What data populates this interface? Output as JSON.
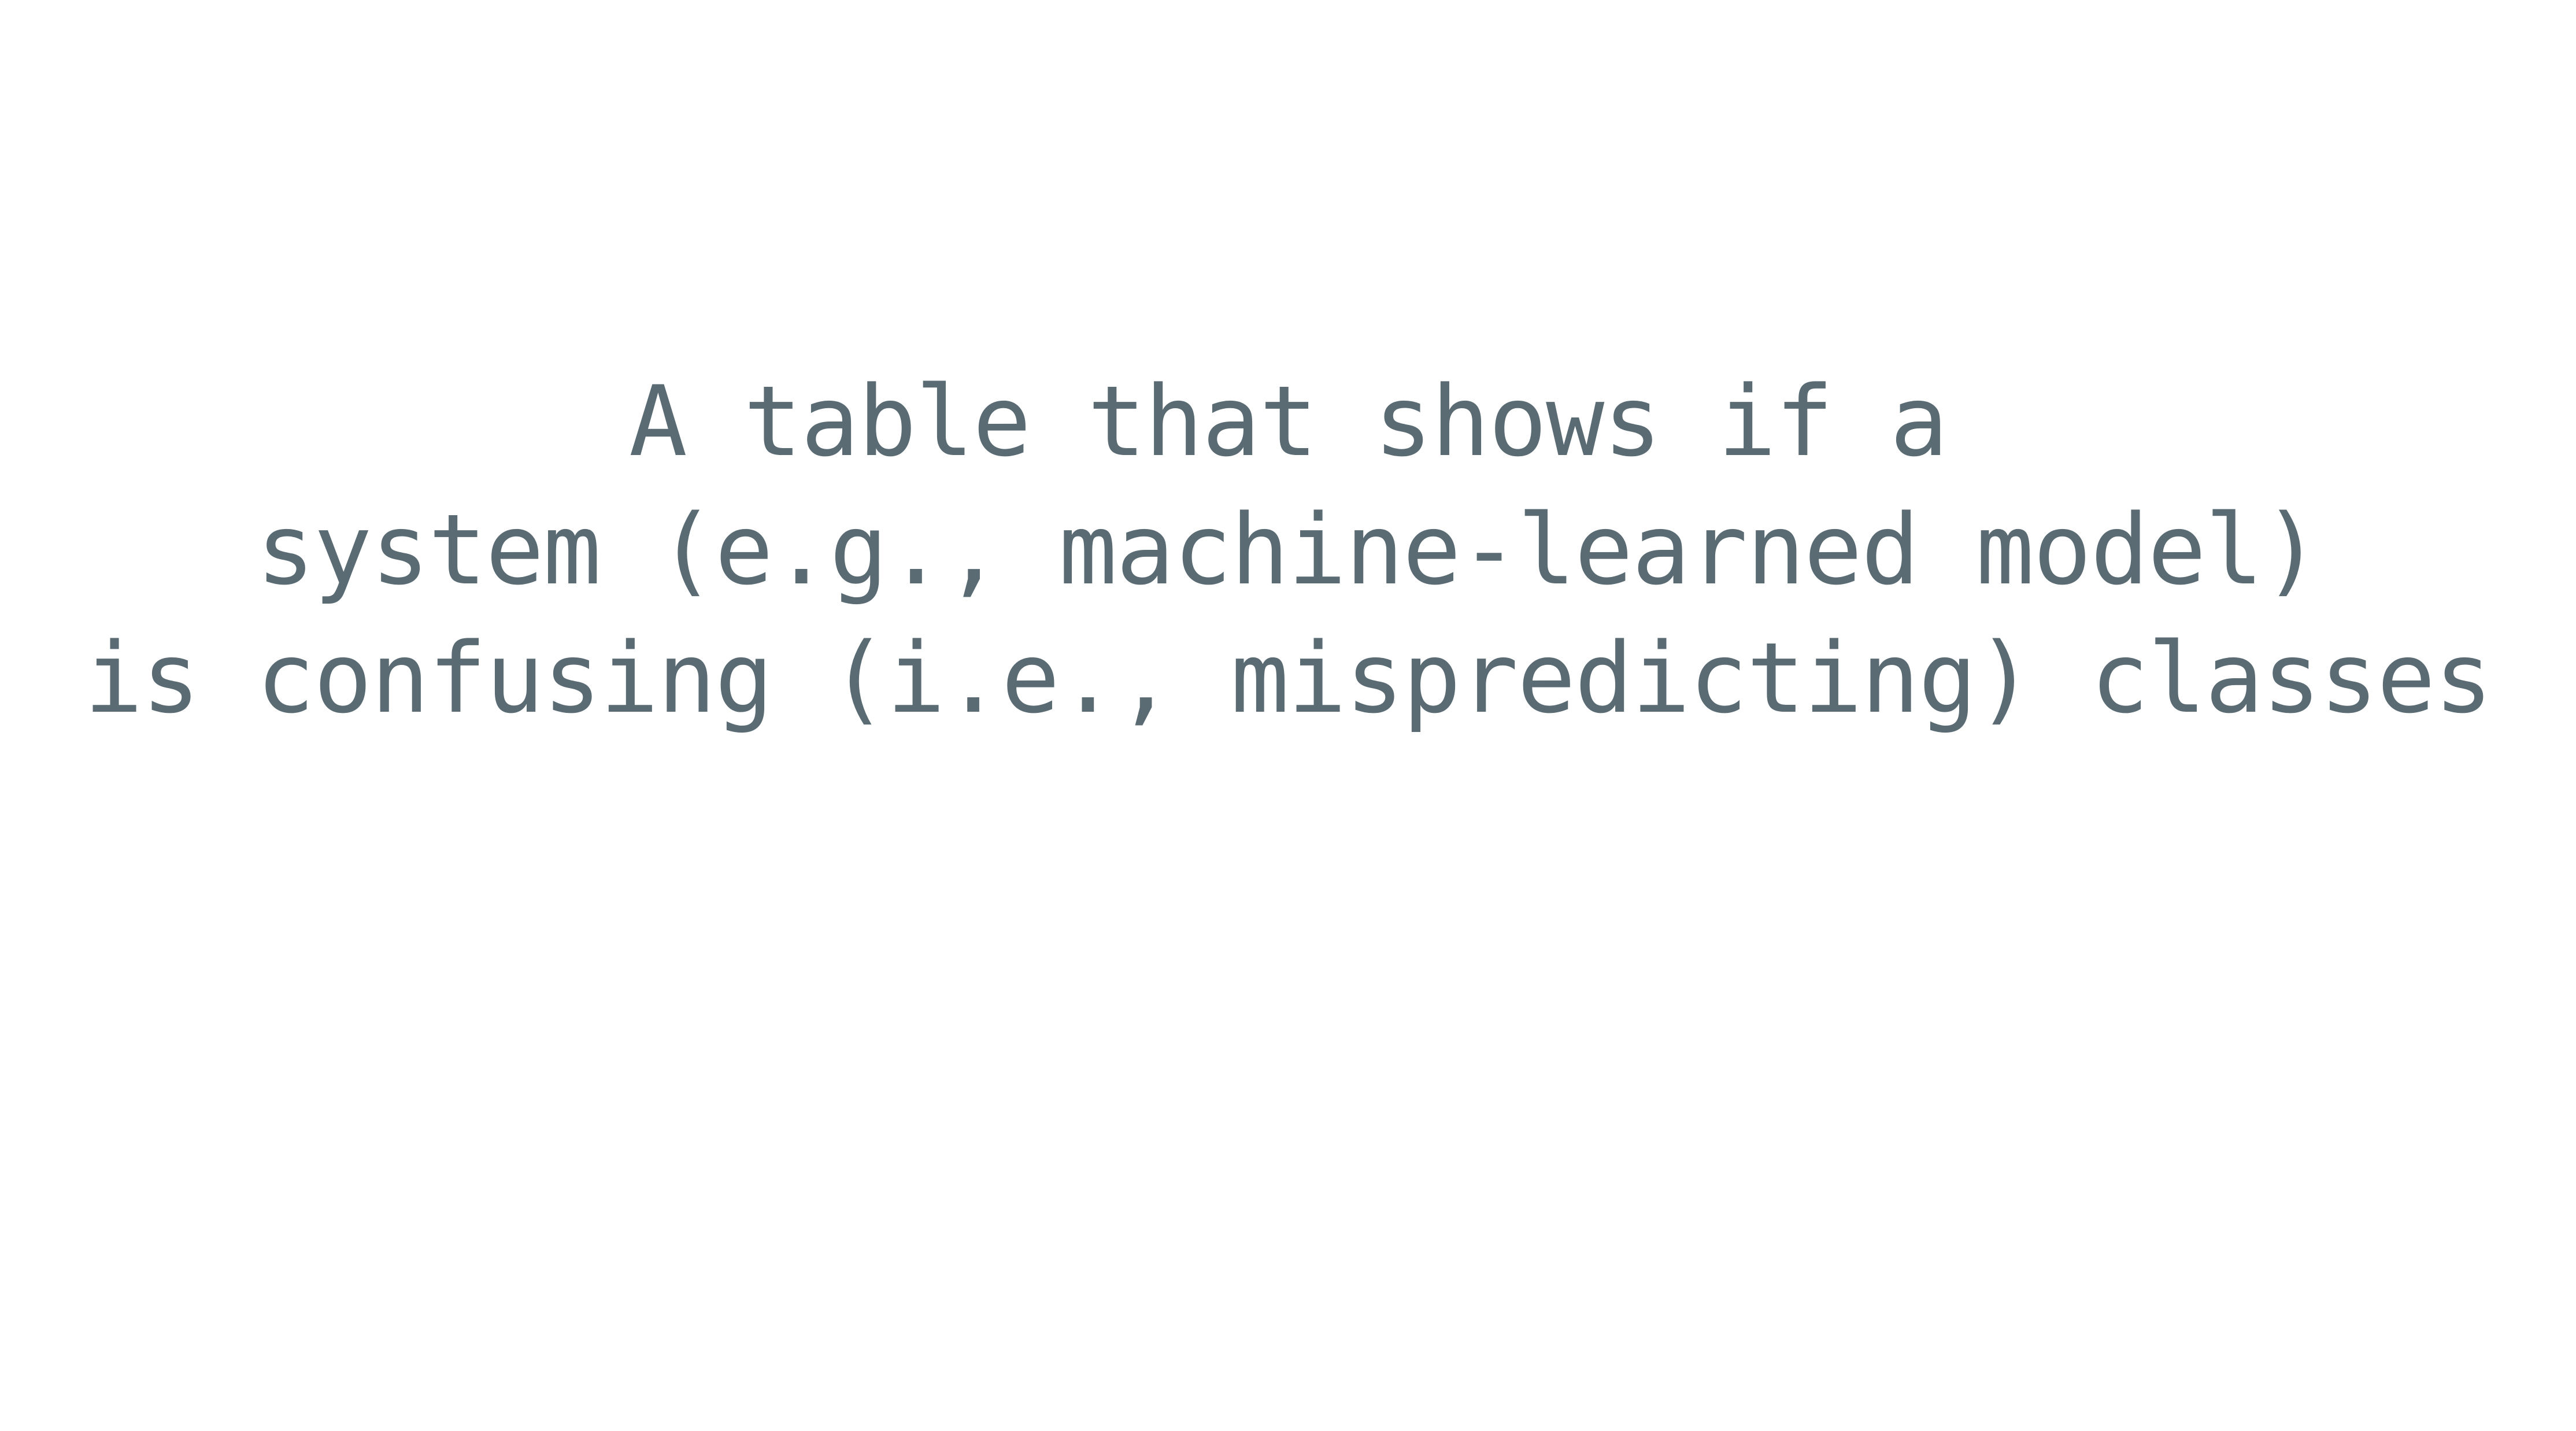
{
  "caption": {
    "lines": [
      "A table that shows if a",
      "system (e.g., machine-learned model)",
      "is confusing (i.e., mispredicting) classes"
    ]
  },
  "colors": {
    "background": "#ffffff",
    "text": "#5a6b73"
  }
}
